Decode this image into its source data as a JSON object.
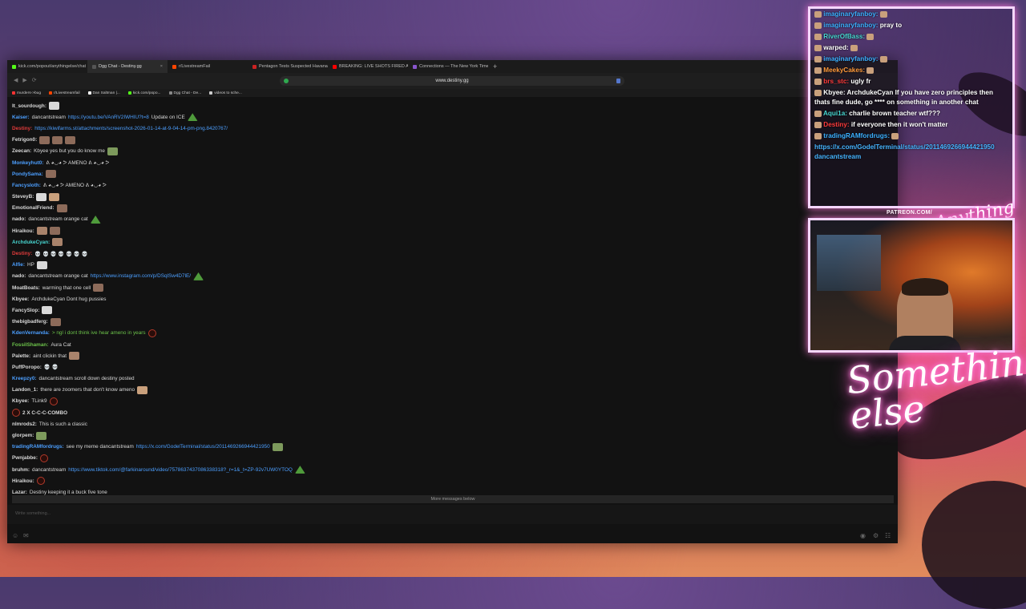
{
  "tabs": [
    {
      "label": "kick.com/popout/anythingelse/chat",
      "color": "#53fc18",
      "active": false
    },
    {
      "label": "Dgg Chat - Destiny.gg",
      "color": "#555555",
      "active": true
    },
    {
      "label": "r/LivestreamFail",
      "color": "#ff4500",
      "active": false
    },
    {
      "label": "Pentagon Tests Suspected Havana",
      "color": "#cc2222",
      "active": false
    },
    {
      "label": "BREAKING: LIVE SHOTS FIRED At",
      "color": "#ff0000",
      "active": false
    },
    {
      "label": "Connections — The New York Time",
      "color": "#8855cc",
      "active": false
    }
  ],
  "address": {
    "url": "www.destiny.gg"
  },
  "bookmarks": [
    {
      "label": "murders->bug",
      "color": "#ff3333"
    },
    {
      "label": "r/Livestreamfail",
      "color": "#ff4500"
    },
    {
      "label": "Dan Saltman |...",
      "color": "#ffffff"
    },
    {
      "label": "kick.com/popo...",
      "color": "#53fc18"
    },
    {
      "label": "Dgg Chat - De...",
      "color": "#888888"
    },
    {
      "label": "videos to sche...",
      "color": "#cccccc"
    }
  ],
  "messages": [
    {
      "user": "lt_sourdough",
      "color": "#d8d8d8",
      "text": "",
      "emotes": [
        "e5"
      ]
    },
    {
      "user": "Kaiser",
      "color": "#4c9fff",
      "text": "dancantstream",
      "link": "https://youtu.be/VAnRV2IWHIU?t=8",
      "after": "Update on ICE",
      "emotes": [
        "pepe"
      ]
    },
    {
      "user": "Destiny",
      "color": "#e03b3b",
      "text": "",
      "link": "https://kiwifarms.st/attachments/screenshot-2026-01-14-at-9-04-14-pm-png.8420767/"
    },
    {
      "user": "Fetrigon0",
      "color": "#d8d8d8",
      "text": "",
      "emotes": [
        "e1",
        "e1",
        "e1"
      ]
    },
    {
      "user": "Zeecan",
      "color": "#d8d8d8",
      "text": "Kbyee yes but you do know me",
      "emotes": [
        "e3"
      ]
    },
    {
      "user": "Monkeyhut0",
      "color": "#4c9fff",
      "text": "ᕕ ◕◡◕ ᕗ AMENO ᕕ ◕◡◕ ᕗ"
    },
    {
      "user": "PondySama",
      "color": "#4c9fff",
      "text": "",
      "emotes": [
        "e1"
      ]
    },
    {
      "user": "Fancysloth",
      "color": "#4c9fff",
      "text": "ᕕ ◕◡◕ ᕗ AMENO ᕕ ◕◡◕ ᕗ"
    },
    {
      "user": "SteveyB",
      "color": "#d8d8d8",
      "text": "",
      "emotes": [
        "e5",
        "e4"
      ]
    },
    {
      "user": "EmotionalFriend",
      "color": "#d8d8d8",
      "text": "",
      "emotes": [
        "e1"
      ]
    },
    {
      "user": "nado",
      "color": "#d8d8d8",
      "text": "dancantstream orange cat",
      "emotes": [
        "pepe"
      ]
    },
    {
      "user": "Hiraikou",
      "color": "#d8d8d8",
      "text": "",
      "emotes": [
        "e2",
        "e1"
      ]
    },
    {
      "user": "ArchdukeCyan",
      "color": "#47d6d0",
      "text": "",
      "emotes": [
        "e2"
      ]
    },
    {
      "user": "Destiny",
      "color": "#e03b3b",
      "text": "💀 💀 💀 💀 💀 💀 💀"
    },
    {
      "user": "Alfie",
      "color": "#4c9fff",
      "text": "HP",
      "emotes": [
        "e5"
      ]
    },
    {
      "user": "nado",
      "color": "#d8d8d8",
      "text": "dancantstream orange cat",
      "link": "https://www.instagram.com/p/DSqlSw4D7lE/",
      "emotes": [
        "pepe"
      ]
    },
    {
      "user": "MoatBoats",
      "color": "#d8d8d8",
      "text": "warming that one cell",
      "emotes": [
        "e1"
      ]
    },
    {
      "user": "Kbyee",
      "color": "#d8d8d8",
      "text": "ArchdukeCyan Dont hug pussies"
    },
    {
      "user": "FancySlop",
      "color": "#d8d8d8",
      "text": "",
      "emotes": [
        "e5"
      ]
    },
    {
      "user": "thebigbadferg",
      "color": "#d8d8d8",
      "text": "",
      "emotes": [
        "e1"
      ]
    },
    {
      "user": "KdenVernanda",
      "color": "#4c9fff",
      "text": "> ngl i dont think ive hear ameno in years",
      "green": true,
      "emotes": [
        "ring"
      ]
    },
    {
      "user": "FossilShaman",
      "color": "#6cc24a",
      "text": "Aura Cat"
    },
    {
      "user": "Palette",
      "color": "#d8d8d8",
      "text": "aint clickin that",
      "emotes": [
        "e2"
      ]
    },
    {
      "user": "PuffPoropo",
      "color": "#d8d8d8",
      "text": "💀 💀"
    },
    {
      "user": "Kreepzy0",
      "color": "#4c9fff",
      "text": "dancantstream scroll down destiny posted"
    },
    {
      "user": "Landon_1",
      "color": "#d8d8d8",
      "text": "there are zoomers that don't know ameno",
      "emotes": [
        "e4"
      ]
    },
    {
      "user": "Kbyee",
      "color": "#d8d8d8",
      "text": "TLink9",
      "emotes": [
        "ring"
      ]
    },
    {
      "user": "",
      "color": "#d8d8d8",
      "text": "2 X C-C-C-COMBO",
      "combo": true
    },
    {
      "user": "nlmrods2",
      "color": "#d8d8d8",
      "text": "This is such a classic"
    },
    {
      "user": "glorpem",
      "color": "#d8d8d8",
      "text": "",
      "emotes": [
        "e3"
      ]
    },
    {
      "user": "tradingRAMfordrugs",
      "color": "#4c9fff",
      "text": "see my meme dancantstream",
      "link": "https://x.com/GodelTerminal/status/2011469266944421950",
      "emotes": [
        "e3"
      ]
    },
    {
      "user": "Pwnjabbe",
      "color": "#d8d8d8",
      "text": "",
      "emotes": [
        "ring"
      ]
    },
    {
      "user": "bruhm",
      "color": "#d8d8d8",
      "text": "dancantstream",
      "link": "https://www.tiktok.com/@farkinaround/video/7578637437086338318?_r=1&_t=ZP-92v7UW0YTOQ",
      "emotes": [
        "pepe"
      ]
    },
    {
      "user": "Hiraikou",
      "color": "#d8d8d8",
      "text": "",
      "emotes": [
        "ring"
      ]
    },
    {
      "user": "Lazar",
      "color": "#d8d8d8",
      "text": "Destiny keeping it a buck five tone"
    }
  ],
  "more_messages": "More messages below",
  "input_placeholder": "Write something...",
  "overlay": {
    "lines": [
      {
        "user": "imaginaryfanboy",
        "user_color": "#3bb0ff",
        "text": ""
      },
      {
        "user": "imaginaryfanboy",
        "user_color": "#3bb0ff",
        "text": "pray to"
      },
      {
        "user": "RiverOfBass",
        "user_color": "#47d6d0",
        "text": ""
      },
      {
        "user": "warped",
        "user_color": "#ffffff",
        "text": ""
      },
      {
        "user": "imaginaryfanboy",
        "user_color": "#3bb0ff",
        "text": ""
      },
      {
        "user": "MeekyCakes",
        "user_color": "#ff9a3b",
        "text": ""
      },
      {
        "user": "brs_stc",
        "user_color": "#ff3b3b",
        "text": "ugly fr"
      },
      {
        "user": "Kbyee",
        "user_color": "#ffffff",
        "text": "ArchdukeCyan If you have zero principles then thats fine dude, go **** on something in another chat"
      },
      {
        "user": "Aqui1a",
        "user_color": "#47d6d0",
        "text": "charlie brown teacher wtf???"
      },
      {
        "user": "Destiny",
        "user_color": "#ff3b3b",
        "text": "if everyone       then it won't matter"
      },
      {
        "user": "tradingRAMfordrugs",
        "user_color": "#3bb0ff",
        "text": ""
      },
      {
        "user": "",
        "user_color": "#ffffff",
        "text": "https://x.com/GodelTerminal/status/2011469266944421950 dancantstream",
        "link": true
      }
    ]
  },
  "patreon": "PATREON.COM/",
  "neon_main": "Something else",
  "neon_small": "Anything else"
}
